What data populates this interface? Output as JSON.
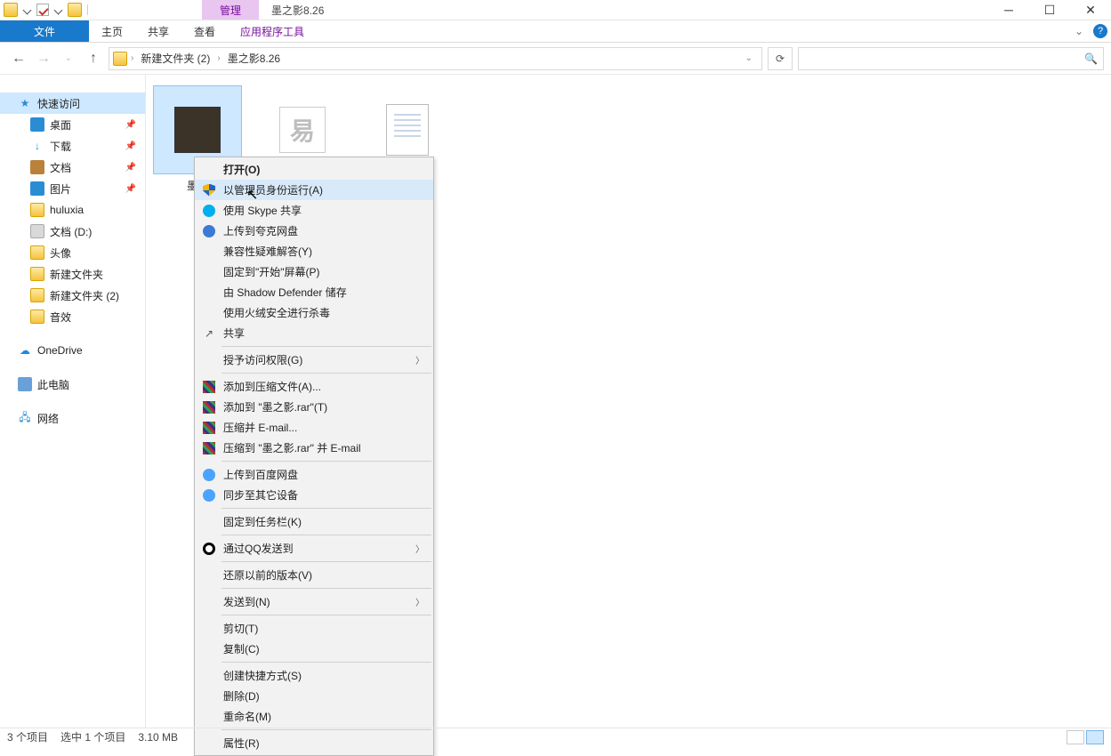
{
  "titlebar": {
    "manage": "管理",
    "title": "墨之影8.26"
  },
  "ribbon": {
    "file": "文件",
    "home": "主页",
    "share": "共享",
    "view": "查看",
    "apptools": "应用程序工具"
  },
  "addressbar": {
    "crumb1": "新建文件夹 (2)",
    "crumb2": "墨之影8.26"
  },
  "search": {
    "placeholder": ""
  },
  "nav": {
    "quick": "快速访问",
    "desktop": "桌面",
    "downloads": "下载",
    "documents": "文档",
    "pictures": "图片",
    "huluxia": "huluxia",
    "docsD": "文档 (D:)",
    "avatar": "头像",
    "newfolder": "新建文件夹",
    "newfolder2": "新建文件夹 (2)",
    "sfx": "音效",
    "onedrive": "OneDrive",
    "thispc": "此电脑",
    "network": "网络"
  },
  "files": {
    "f1": "墨之",
    "f2": "",
    "f3": ""
  },
  "ctx": {
    "open": "打开(O)",
    "runAdmin": "以管理员身份运行(A)",
    "skype": "使用 Skype 共享",
    "quark": "上传到夸克网盘",
    "compat": "兼容性疑难解答(Y)",
    "pinStart": "固定到\"开始\"屏幕(P)",
    "shadow": "由 Shadow Defender 储存",
    "huorong": "使用火绒安全进行杀毒",
    "share": "共享",
    "grant": "授予访问权限(G)",
    "addArchive": "添加到压缩文件(A)...",
    "addRar": "添加到 \"墨之影.rar\"(T)",
    "emailZip": "压缩并 E-mail...",
    "emailRar": "压缩到 \"墨之影.rar\" 并 E-mail",
    "baidu": "上传到百度网盘",
    "sync": "同步至其它设备",
    "pinTask": "固定到任务栏(K)",
    "qq": "通过QQ发送到",
    "restore": "还原以前的版本(V)",
    "sendto": "发送到(N)",
    "cut": "剪切(T)",
    "copy": "复制(C)",
    "shortcut": "创建快捷方式(S)",
    "delete": "删除(D)",
    "rename": "重命名(M)",
    "props": "属性(R)"
  },
  "status": {
    "count": "3 个项目",
    "selected": "选中 1 个项目",
    "size": "3.10 MB"
  }
}
